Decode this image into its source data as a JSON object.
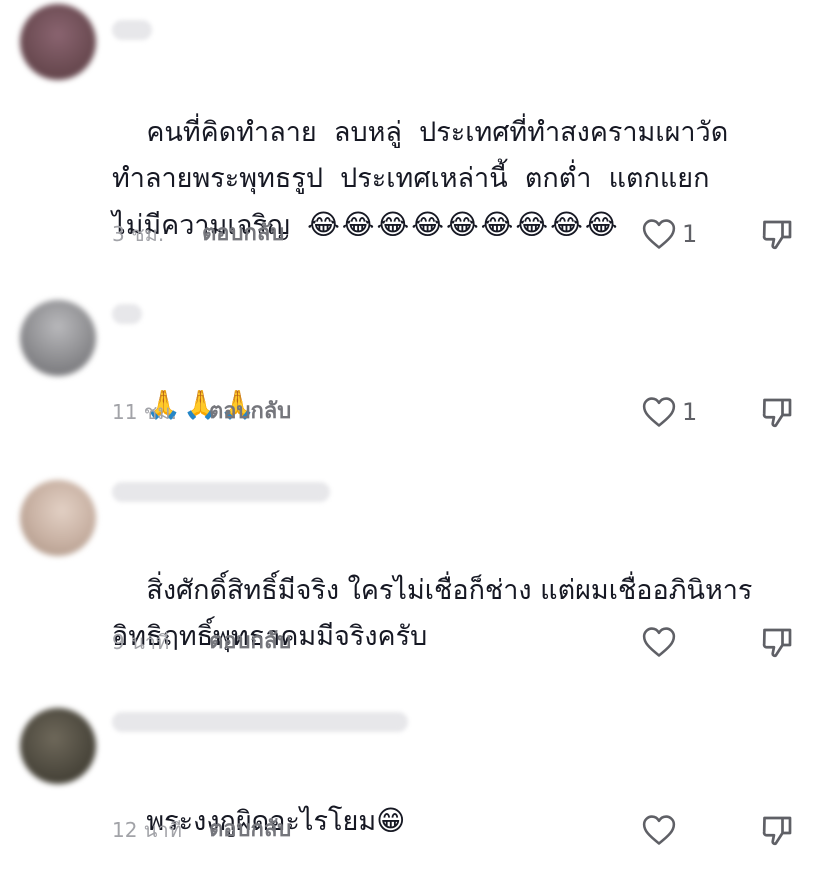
{
  "comments": [
    {
      "text": "คนที่คิดทำลาย  ลบหลู่  ประเทศที่ทำสงครามเผาวัด\nทำลายพระพุทธรูป  ประเทศเหล่านี้  ตกต่ำ  แตกแยก\nไม่มีความเจริญ",
      "emoji": "😂😂😂😂😂😂😂😂😂",
      "time": "3 ชม.",
      "reply_label": "ตอบกลับ",
      "like_count": "1",
      "avatar_color": "#6b4b52"
    },
    {
      "text": "",
      "emoji": "🙏🙏🙏",
      "time": "11 ชม.",
      "reply_label": "ตอบกลับ",
      "like_count": "1",
      "avatar_color": "#8d8d90"
    },
    {
      "text": "สิ่งศักดิ์สิทธิ์มีจริง ใครไม่เชื่อก็ช่าง แต่ผมเชื่ออภินิหาร\nอิทธิฤทธิ์พุทธาคมมีจริงครับ",
      "emoji": "",
      "time": "9 นาที",
      "reply_label": "ตอบกลับ",
      "like_count": "",
      "avatar_color": "#c9b2a4"
    },
    {
      "text": "พระงงกูผิดอะไรโยม",
      "emoji": "😁",
      "time": "12 นาที",
      "reply_label": "ตอบกลับ",
      "like_count": "",
      "avatar_color": "#4e4a3f"
    }
  ],
  "colors": {
    "text": "#161823",
    "meta": "#a2a3a8",
    "icon": "#5f6066"
  },
  "icons": {
    "like": "heart-outline-icon",
    "dislike": "thumbs-down-outline-icon"
  }
}
